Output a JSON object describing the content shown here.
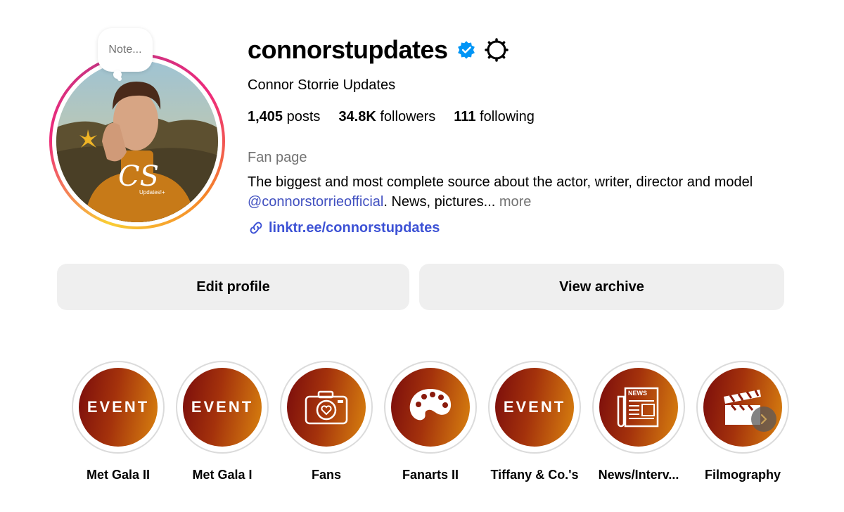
{
  "note": {
    "text": "Note..."
  },
  "profile": {
    "username": "connorstupdates",
    "full_name": "Connor Storrie Updates",
    "avatar_monogram": "CS",
    "avatar_caption": "Updates!+",
    "stats": {
      "posts_count": "1,405",
      "posts_label": "posts",
      "followers_count": "34.8K",
      "followers_label": "followers",
      "following_count": "111",
      "following_label": "following"
    },
    "category": "Fan page",
    "bio": {
      "text_before": "The biggest and most complete source about the actor, writer, director and model ",
      "mention": "@connorstorrieofficial",
      "text_after": ". News, pictures... ",
      "more": "more"
    },
    "link": "linktr.ee/connorstupdates"
  },
  "buttons": {
    "edit_profile": "Edit profile",
    "view_archive": "View archive"
  },
  "highlights": [
    {
      "label": "Met Gala II",
      "icon": "event-text",
      "cover_text": "EVENT"
    },
    {
      "label": "Met Gala I",
      "icon": "event-text",
      "cover_text": "EVENT"
    },
    {
      "label": "Fans",
      "icon": "camera-heart-icon"
    },
    {
      "label": "Fanarts II",
      "icon": "palette-icon"
    },
    {
      "label": "Tiffany & Co.'s",
      "icon": "event-text",
      "cover_text": "EVENT"
    },
    {
      "label": "News/Interv...",
      "icon": "newspaper-icon",
      "cover_text": "NEWS"
    },
    {
      "label": "Filmography",
      "icon": "clapperboard-icon"
    }
  ],
  "colors": {
    "link": "#3d52d5",
    "mention": "#4150c0",
    "secondary_text": "#737373",
    "button_bg": "#efefef",
    "verified": "#0095f6"
  }
}
